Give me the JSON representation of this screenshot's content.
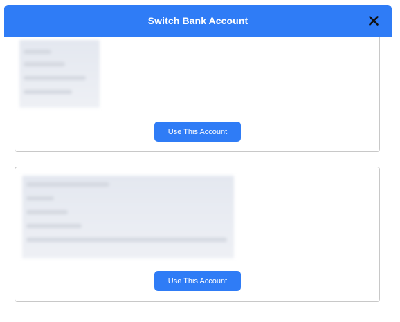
{
  "modal": {
    "title": "Switch Bank Account",
    "close_icon": "close-icon"
  },
  "accounts": [
    {
      "details": "redacted",
      "use_label": "Use This Account"
    },
    {
      "details": "redacted",
      "use_label": "Use This Account"
    }
  ],
  "colors": {
    "accent": "#2f7cf6",
    "card_border": "#c8c8c8"
  }
}
